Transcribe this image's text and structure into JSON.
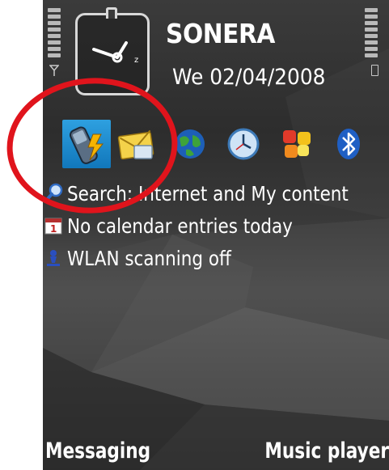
{
  "status": {
    "operator": "SONERA",
    "date": "We 02/04/2008"
  },
  "shortcuts": [
    {
      "icon": "phone-call-icon",
      "selected": true
    },
    {
      "icon": "messaging-envelope-icon",
      "selected": false
    },
    {
      "icon": "globe-web-icon",
      "selected": false
    },
    {
      "icon": "clock-app-icon",
      "selected": false
    },
    {
      "icon": "gallery-icon",
      "selected": false
    },
    {
      "icon": "bluetooth-icon",
      "selected": false
    }
  ],
  "list": [
    {
      "icon": "search-icon",
      "text": "Search: Internet and My content"
    },
    {
      "icon": "calendar-icon",
      "text": "No calendar entries today"
    },
    {
      "icon": "wlan-icon",
      "text": "WLAN scanning off"
    }
  ],
  "softkeys": {
    "left": "Messaging",
    "right": "Music player"
  },
  "colors": {
    "selection": "#1e8ad0",
    "annotation": "#e0141c",
    "text": "#ffffff"
  }
}
